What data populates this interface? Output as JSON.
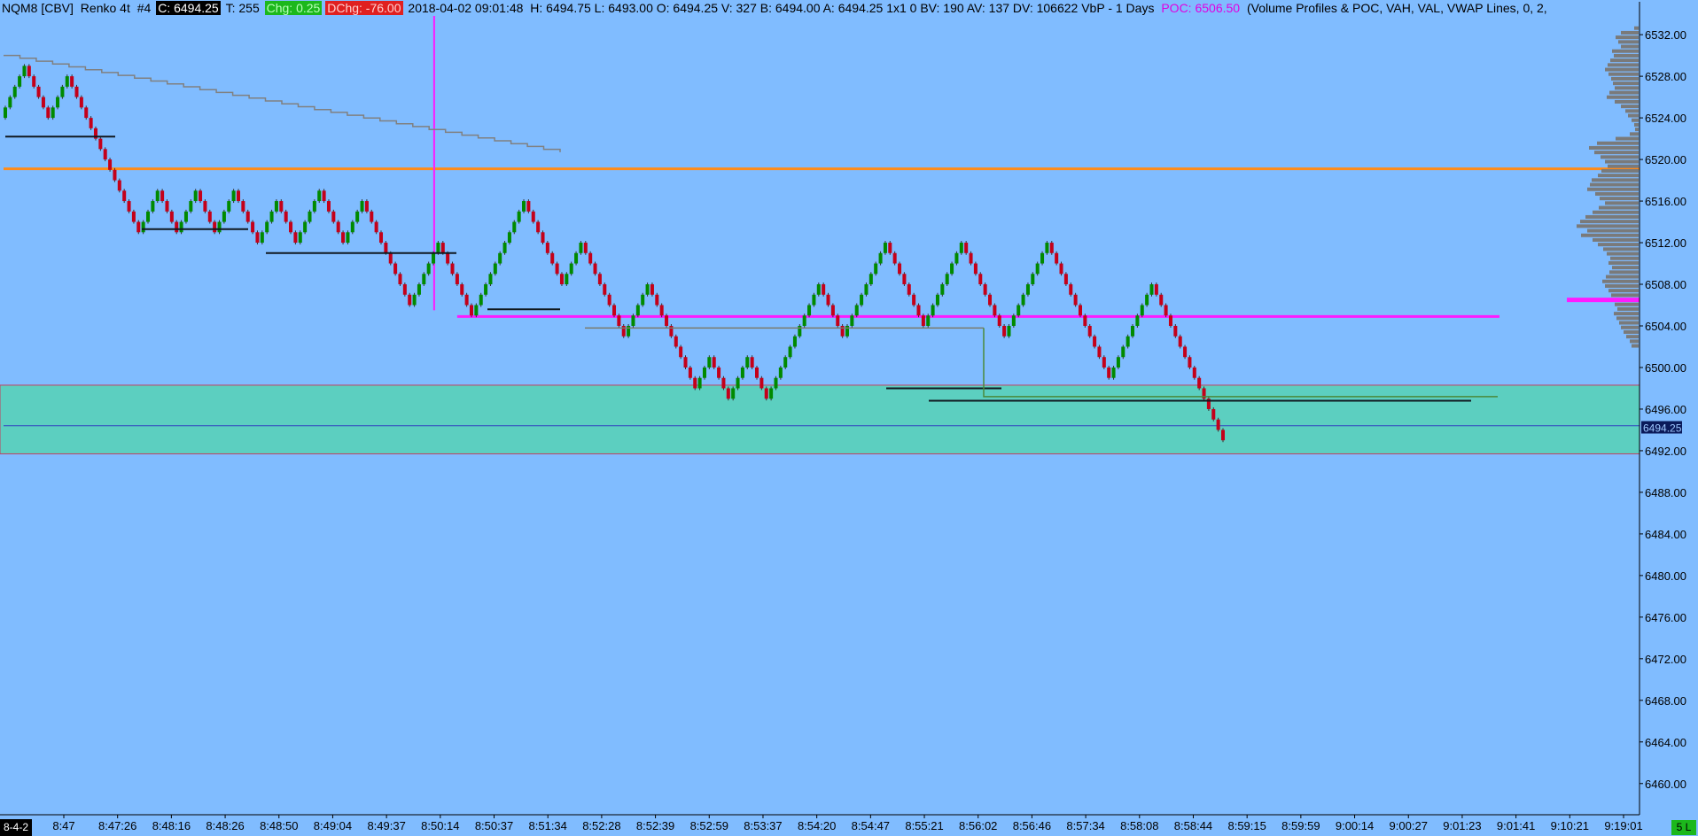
{
  "header": {
    "symbol": "NQM8 [CBV]",
    "chart_type": "Renko 4t",
    "chart_number": "#4",
    "close": "C: 6494.25",
    "trades": "T: 255",
    "change": "Chg: 0.25",
    "daily_change": "DChg: -76.00",
    "datetime": "2018-04-02 09:01:48",
    "ohlc": "H: 6494.75 L: 6493.00 O: 6494.25 V: 327 B: 6494.00 A: 6494.25 1x1 0 BV: 190 AV: 137 DV: 106622 VbP - 1 Days",
    "poc": "POC: 6506.50",
    "study": "(Volume Profiles & POC, VAH, VAL, VWAP Lines, 0, 2,"
  },
  "colors": {
    "background": "#80bcff",
    "up_bar": "#008a00",
    "down_bar": "#c4001a",
    "orange_line": "#ff8c1a",
    "magenta_line": "#ff1aff",
    "value_area": "#5ccfc0",
    "value_area_border": "#c04060",
    "profile": "#7a7a7a"
  },
  "chart_data": {
    "type": "renko",
    "brick_size": 1.0,
    "y_ticks": [
      "6532.00",
      "6528.00",
      "6524.00",
      "6520.00",
      "6516.00",
      "6512.00",
      "6508.00",
      "6504.00",
      "6500.00",
      "6496.00",
      "6492.00",
      "6488.00",
      "6484.00",
      "6480.00",
      "6476.00",
      "6472.00",
      "6468.00",
      "6464.00",
      "6460.00"
    ],
    "y_range": [
      6457.0,
      6533.8
    ],
    "x_ticks": [
      "8:47",
      "8:47:26",
      "8:48:16",
      "8:48:26",
      "8:48:50",
      "8:49:04",
      "8:49:37",
      "8:50:14",
      "8:50:37",
      "8:51:34",
      "8:52:28",
      "8:52:39",
      "8:52:59",
      "8:53:37",
      "8:54:20",
      "8:54:47",
      "8:55:21",
      "8:56:02",
      "8:56:46",
      "8:57:34",
      "8:58:08",
      "8:58:44",
      "8:59:15",
      "8:59:59",
      "9:00:14",
      "9:00:27",
      "9:01:23",
      "9:01:41",
      "9:10:21",
      "9:19:01"
    ],
    "levels": {
      "orange": 6519.1,
      "magenta": 6504.9,
      "value_area_high": 6498.3,
      "value_area_low": 6491.7,
      "blue": 6494.4,
      "current_price": "6494.25"
    },
    "waypoints": [
      6524,
      6529,
      6524,
      6528,
      6523,
      6518,
      6513,
      6517,
      6513,
      6517,
      6513,
      6517,
      6512,
      6516,
      6512,
      6517,
      6512,
      6516,
      6506,
      6512,
      6506,
      6505,
      6510,
      6516,
      6508,
      6512,
      6503,
      6508,
      6498,
      6501,
      6497,
      6501,
      6497,
      6508,
      6503,
      6512,
      6504,
      6512,
      6503,
      6512,
      6499,
      6508,
      6505,
      6493
    ],
    "profile_top_price": 6532.8,
    "profile_widths": [
      5,
      20,
      26,
      23,
      20,
      30,
      28,
      32,
      35,
      38,
      34,
      31,
      29,
      27,
      33,
      36,
      27,
      20,
      15,
      12,
      8,
      5,
      4,
      10,
      26,
      47,
      56,
      50,
      43,
      38,
      35,
      42,
      46,
      53,
      55,
      58,
      49,
      44,
      38,
      45,
      52,
      60,
      66,
      70,
      58,
      65,
      52,
      46,
      40,
      36,
      32,
      34,
      30,
      33,
      37,
      41,
      38,
      34,
      31,
      29,
      27,
      24,
      28,
      25,
      22,
      20,
      17,
      14,
      10,
      8
    ]
  },
  "footer": {
    "date_tag": "8-4-2",
    "bars_tag": "5 L"
  }
}
